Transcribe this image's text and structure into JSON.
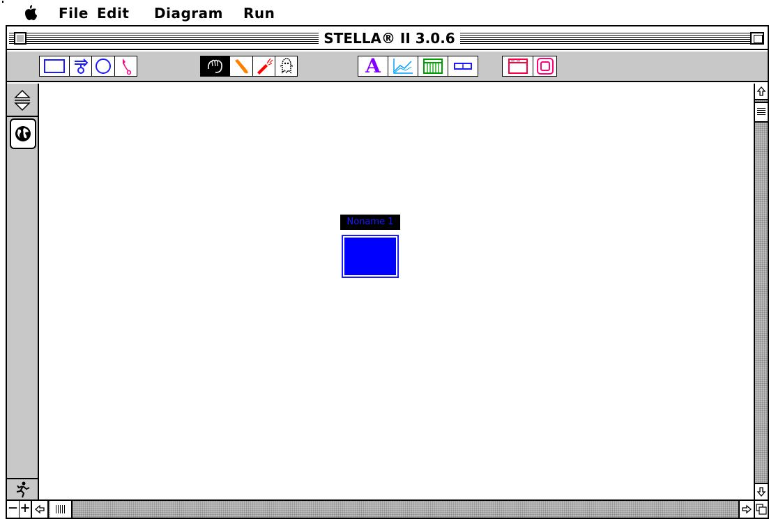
{
  "menubar": {
    "apple_icon": "apple-icon",
    "items": [
      {
        "label": "File"
      },
      {
        "label": "Edit"
      },
      {
        "label": "Diagram"
      },
      {
        "label": "Run"
      }
    ]
  },
  "window": {
    "title": "STELLA® II 3.0.6"
  },
  "toolbar": {
    "tools": [
      {
        "name": "stock-tool",
        "icon": "rectangle-icon",
        "color": "#1a1aff"
      },
      {
        "name": "flow-tool",
        "icon": "flow-icon",
        "color": "#1a1aff"
      },
      {
        "name": "converter-tool",
        "icon": "circle-icon",
        "color": "#1a1aff"
      },
      {
        "name": "connector-tool",
        "icon": "connector-arrow-icon",
        "color": "#ff0080"
      },
      {
        "name": "hand-tool",
        "icon": "hand-icon",
        "color": "#000000",
        "selected": true
      },
      {
        "name": "paintbrush-tool",
        "icon": "paintbrush-icon",
        "color": "#ff8000"
      },
      {
        "name": "dynamite-tool",
        "icon": "dynamite-icon",
        "color": "#ff0000"
      },
      {
        "name": "ghost-tool",
        "icon": "ghost-icon",
        "color": "#000000"
      },
      {
        "name": "text-tool",
        "icon": "text-a-icon",
        "color": "#8000ff",
        "label": "A"
      },
      {
        "name": "graph-tool",
        "icon": "graph-icon",
        "color": "#00a0ff"
      },
      {
        "name": "table-tool",
        "icon": "table-icon",
        "color": "#00a000"
      },
      {
        "name": "slider-tool",
        "icon": "slider-icon",
        "color": "#1a1aff"
      },
      {
        "name": "button-tool",
        "icon": "button-icon",
        "color": "#ff0040"
      },
      {
        "name": "sector-tool",
        "icon": "sector-frame-icon",
        "color": "#ff0080"
      }
    ]
  },
  "left_palette": {
    "layer_toggle_icon": "up-down-arrows-icon",
    "globe_icon": "globe-icon",
    "run_icon": "running-man-icon"
  },
  "canvas": {
    "sector_label": "Noname 1",
    "sector_fill": "#0000ff",
    "label_color": "#1a1aff"
  },
  "bottombar": {
    "zoom_out": "−",
    "zoom_in": "+"
  }
}
